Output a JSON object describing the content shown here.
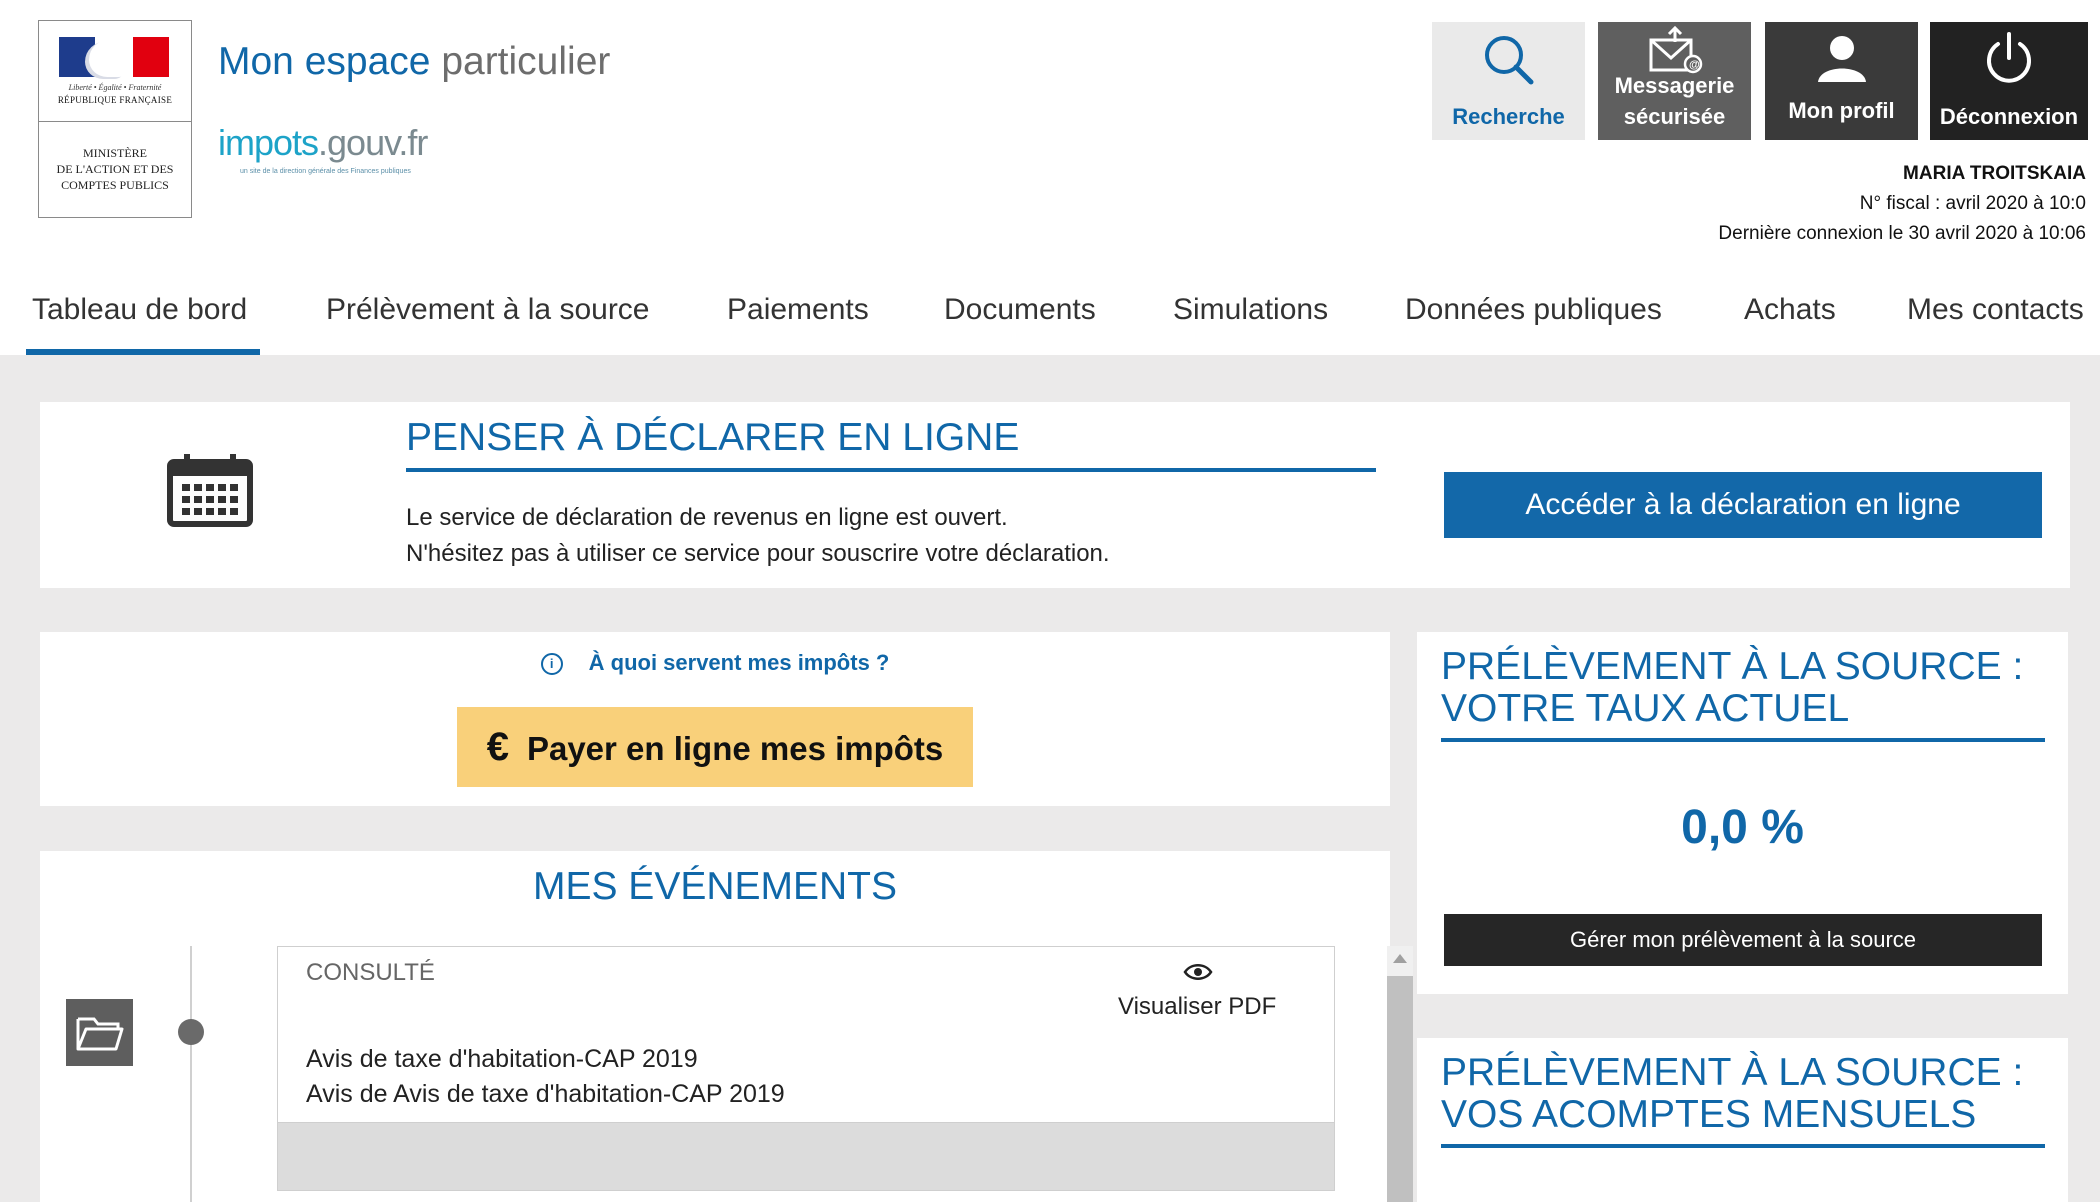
{
  "header": {
    "logo": {
      "motto": "Liberté • Égalité • Fraternité",
      "republic": "RÉPUBLIQUE FRANÇAISE",
      "ministry_line1": "MINISTÈRE",
      "ministry_line2": "DE L'ACTION ET DES",
      "ministry_line3": "COMPTES PUBLICS"
    },
    "site_title_main": "Mon espace",
    "site_title_light": "particulier",
    "impots_main": "impots",
    "impots_gouv": ".gouv.fr",
    "impots_tagline": "un site de la direction générale des Finances publiques"
  },
  "top_buttons": {
    "search": {
      "label": "Recherche",
      "icon": "search-icon"
    },
    "mail": {
      "label_line1": "Messagerie",
      "label_line2": "sécurisée",
      "icon": "envelope-icon"
    },
    "profile": {
      "label": "Mon profil",
      "icon": "user-icon"
    },
    "logout": {
      "label": "Déconnexion",
      "icon": "power-icon"
    }
  },
  "user": {
    "name": "MARIA TROITSKAIA",
    "fiscal": "N° fiscal : avril 2020 à 10:0",
    "last_login": "Dernière connexion le 30 avril 2020 à 10:06"
  },
  "nav": {
    "items": [
      {
        "label": "Tableau de bord",
        "active": true
      },
      {
        "label": "Prélèvement à la source",
        "active": false
      },
      {
        "label": "Paiements",
        "active": false
      },
      {
        "label": "Documents",
        "active": false
      },
      {
        "label": "Simulations",
        "active": false
      },
      {
        "label": "Données publiques",
        "active": false
      },
      {
        "label": "Achats",
        "active": false
      },
      {
        "label": "Mes contacts",
        "active": false
      }
    ]
  },
  "declare_card": {
    "icon": "calendar-icon",
    "title": "PENSER À DÉCLARER EN LIGNE",
    "text_line1": "Le service de déclaration de revenus en ligne est ouvert.",
    "text_line2": "N'hésitez pas à utiliser ce service pour souscrire votre déclaration.",
    "button": "Accéder à la déclaration en ligne"
  },
  "pay_card": {
    "info_icon": "info-icon",
    "info_link": "À quoi servent mes impôts ?",
    "euro": "€",
    "pay_button": "Payer en ligne mes impôts"
  },
  "events": {
    "title": "MES ÉVÉNEMENTS",
    "item": {
      "icon": "folder-icon",
      "status": "CONSULTÉ",
      "view_icon": "eye-icon",
      "view_label": "Visualiser  PDF",
      "line1": "Avis de taxe d'habitation-CAP 2019",
      "line2": "Avis de Avis de taxe d'habitation-CAP 2019"
    }
  },
  "rate_card": {
    "title": "PRÉLÈVEMENT À LA SOURCE : VOTRE TAUX ACTUEL",
    "rate": "0,0 %",
    "button": "Gérer mon prélèvement à la source"
  },
  "installments_card": {
    "title": "PRÉLÈVEMENT À LA SOURCE : VOS ACOMPTES MENSUELS"
  },
  "colors": {
    "primary_blue": "#1067a8",
    "pay_yellow": "#f9d07a",
    "dark_button": "#262626",
    "page_bg": "#ebeaea"
  }
}
